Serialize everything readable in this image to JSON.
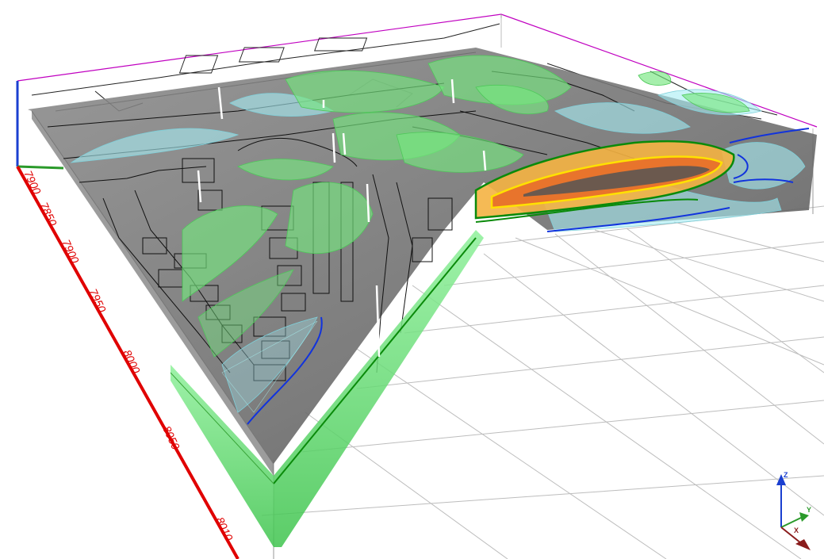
{
  "scene": {
    "axis_ticks": [
      "7900",
      "7850",
      "7900",
      "7950",
      "8000",
      "8050",
      "8010"
    ],
    "triad": {
      "z_label": "Z",
      "y_label": "Y",
      "x_label": "X"
    }
  },
  "colors": {
    "background": "#ffffff",
    "grid": "#b8b8b8",
    "box_edge": "#c000c0",
    "axis_red": "#e00000",
    "axis_blue": "#1a3fd0",
    "axis_green": "#2a9a2a",
    "slab": "#6e6e6e",
    "plume_green": "#6fe27a",
    "plume_cyan": "#9fe7ef",
    "contour_yellow": "#ffe100",
    "contour_orange": "#e8742c",
    "contour_blue": "#1133dd",
    "contour_green": "#0a8a0a"
  }
}
